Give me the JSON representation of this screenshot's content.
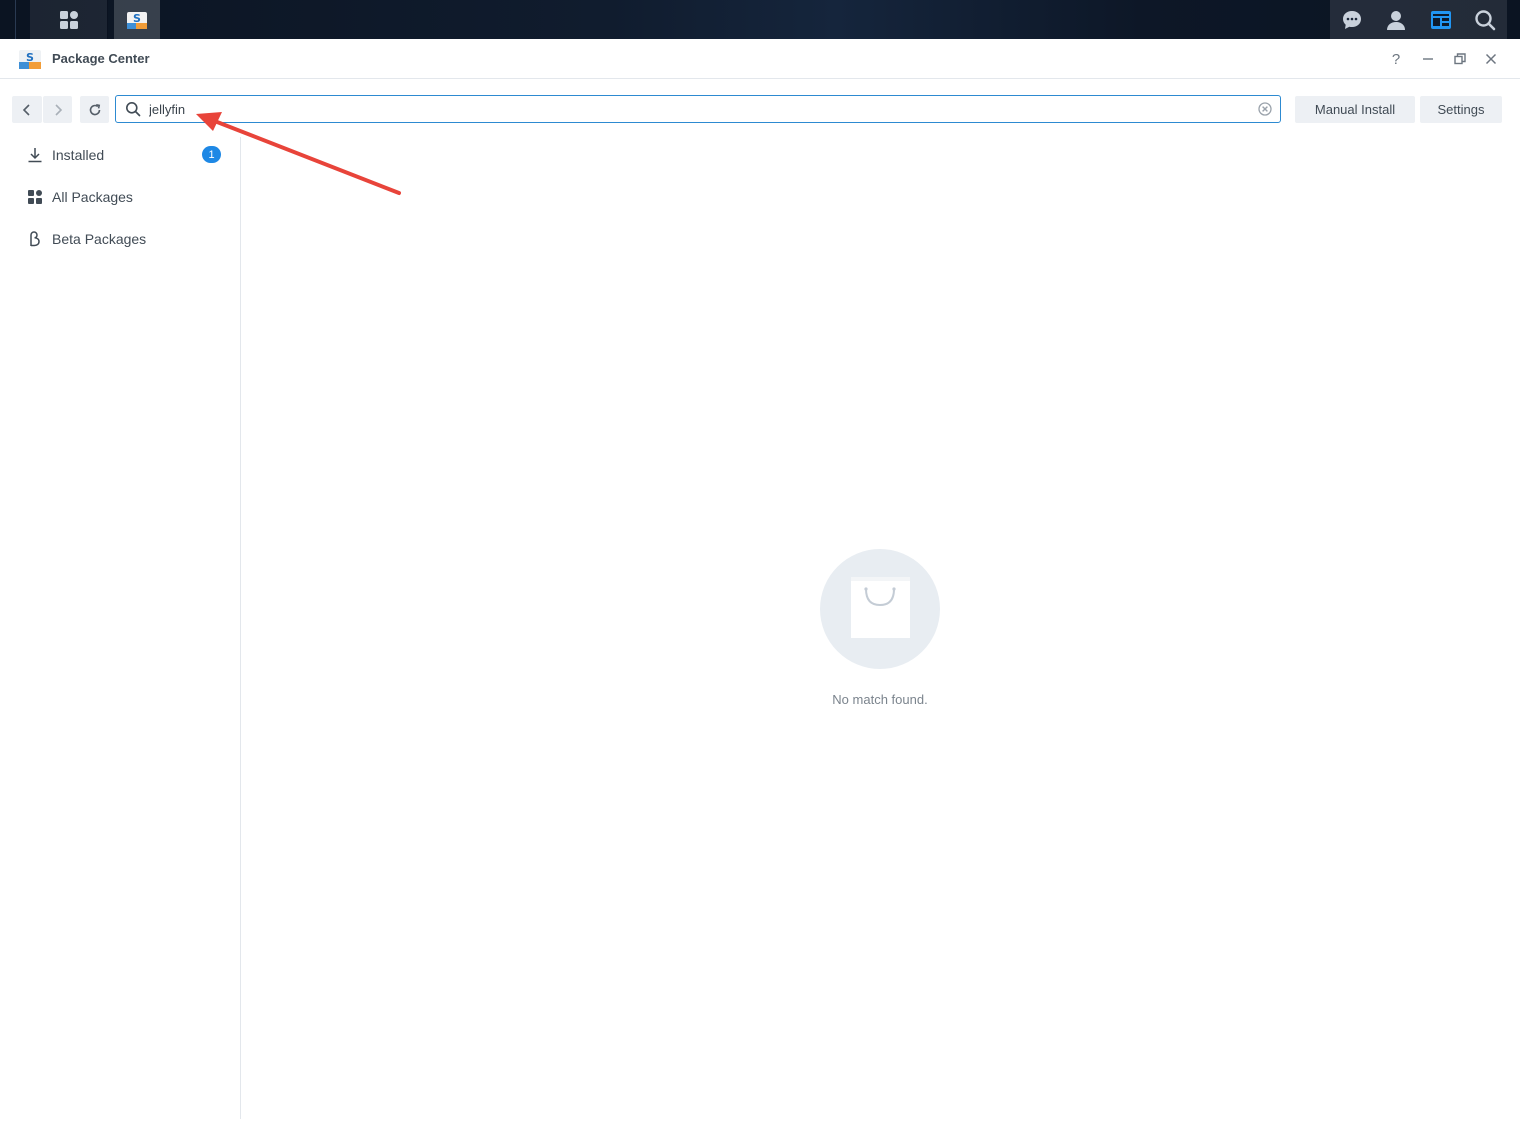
{
  "taskbar": {
    "icons": [
      "main-menu-icon",
      "package-center-app-icon",
      "chat-icon",
      "user-icon",
      "widgets-icon",
      "search-icon"
    ]
  },
  "window": {
    "title": "Package Center",
    "controls": {
      "help": "?",
      "minimize": "–",
      "restore": "🗗",
      "close": "✕"
    }
  },
  "toolbar": {
    "search_value": "jellyfin",
    "manual_install_label": "Manual Install",
    "settings_label": "Settings"
  },
  "sidebar": {
    "items": [
      {
        "label": "Installed",
        "icon": "download-icon",
        "badge": "1"
      },
      {
        "label": "All Packages",
        "icon": "grid-icon"
      },
      {
        "label": "Beta Packages",
        "icon": "beta-icon"
      }
    ]
  },
  "main": {
    "empty_message": "No match found."
  },
  "colors": {
    "accent": "#1e88e5",
    "annotation_arrow": "#e8443a"
  }
}
